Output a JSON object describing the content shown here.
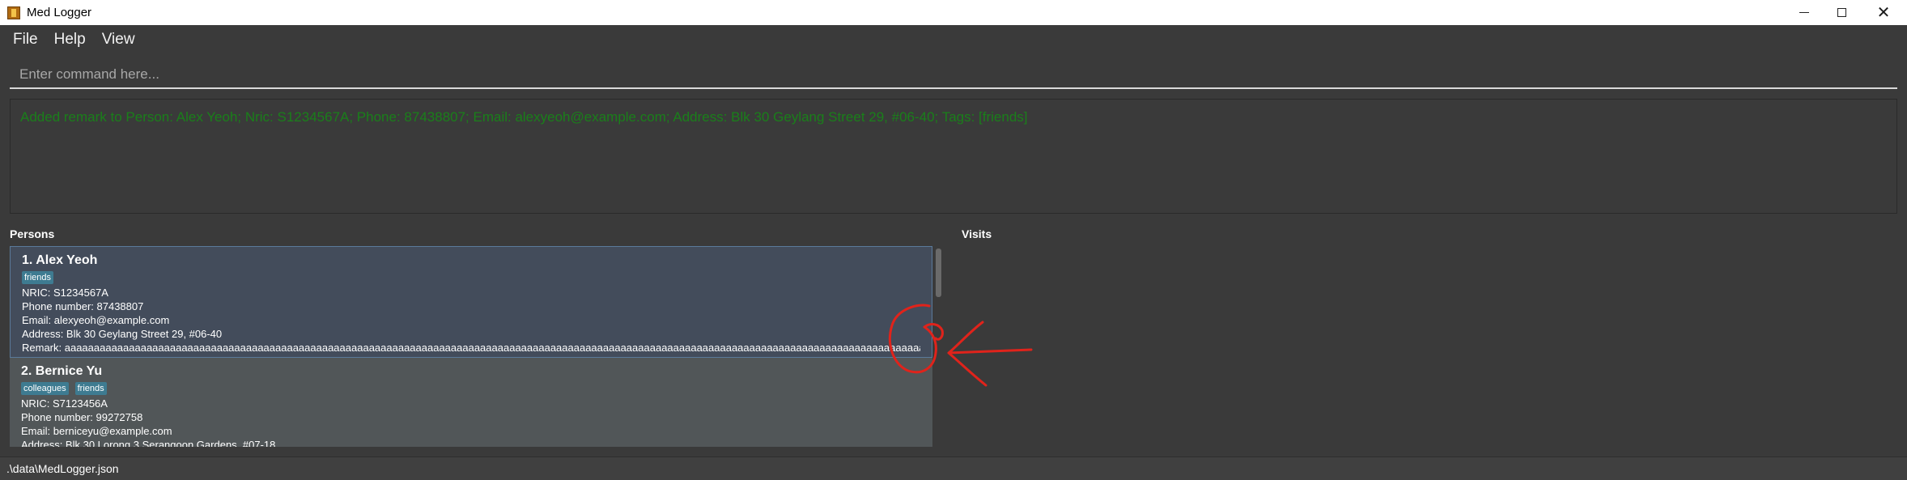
{
  "window": {
    "title": "Med Logger",
    "controls": {
      "minimize_icon": "minimize-icon",
      "maximize_icon": "maximize-icon",
      "close_glyph": "✕"
    }
  },
  "menu": {
    "items": [
      "File",
      "Help",
      "View"
    ]
  },
  "command": {
    "placeholder": "Enter command here...",
    "value": ""
  },
  "result": {
    "text": "Added remark to Person: Alex Yeoh; Nric: S1234567A; Phone: 87438807; Email: alexyeoh@example.com; Address: Blk 30 Geylang Street 29, #06-40; Tags: [friends]",
    "color": "#1a7f1a"
  },
  "panels": {
    "persons_title": "Persons",
    "visits_title": "Visits"
  },
  "persons": [
    {
      "name": "1. Alex Yeoh",
      "tags": [
        "friends"
      ],
      "nric": "NRIC: S1234567A",
      "phone": "Phone number: 87438807",
      "email": "Email: alexyeoh@example.com",
      "address": "Address: Blk 30 Geylang Street 29, #06-40",
      "remark": "Remark: aaaaaaaaaaaaaaaaaaaaaaaaaaaaaaaaaaaaaaaaaaaaaaaaaaaaaaaaaaaaaaaaaaaaaaaaaaaaaaaaaaaaaaaaaaaaaaaaaaaaaaaaaaaaaaaaaaaaaaaaaaaaaaaaaaaaaaaaaaaaaaaaaaaaaaaaaaaaaa..."
    },
    {
      "name": "2. Bernice Yu",
      "tags": [
        "colleagues",
        "friends"
      ],
      "nric": "NRIC: S7123456A",
      "phone": "Phone number: 99272758",
      "email": "Email: berniceyu@example.com",
      "address": "Address: Blk 30 Lorong 3 Serangoon Gardens, #07-18"
    }
  ],
  "status": {
    "path": ".\\data\\MedLogger.json"
  },
  "colors": {
    "tag": "#3e7b91",
    "selected_card": "#434c5b",
    "card": "#515658",
    "annotation": "#e0231b"
  }
}
